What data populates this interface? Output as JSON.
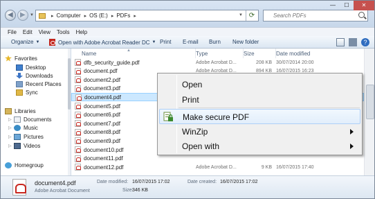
{
  "window": {
    "address": {
      "crumbs": [
        "Computer",
        "OS (E:)",
        "PDFs"
      ]
    },
    "search": {
      "placeholder": "Search PDFs"
    },
    "controls": {
      "minimize": "—",
      "maximize": "☐",
      "close": "✕"
    }
  },
  "menu": [
    "File",
    "Edit",
    "View",
    "Tools",
    "Help"
  ],
  "toolbar": {
    "organize": "Organize",
    "open_with": "Open with Adobe Acrobat Reader DC",
    "print": "Print",
    "email": "E-mail",
    "burn": "Burn",
    "new_folder": "New folder"
  },
  "nav": {
    "favorites": "Favorites",
    "desktop": "Desktop",
    "downloads": "Downloads",
    "recent": "Recent Places",
    "sync": "Sync",
    "libraries": "Libraries",
    "documents": "Documents",
    "music": "Music",
    "pictures": "Pictures",
    "videos": "Videos",
    "homegroup": "Homegroup"
  },
  "columns": {
    "name": "Name",
    "type": "Type",
    "size": "Size",
    "date": "Date modified"
  },
  "files": [
    {
      "name": "dfb_security_guide.pdf",
      "type": "Adobe Acrobat D...",
      "size": "208 KB",
      "date": "30/07/2014 20:00"
    },
    {
      "name": "document.pdf",
      "type": "Adobe Acrobat D...",
      "size": "894 KB",
      "date": "16/07/2015 16:23"
    },
    {
      "name": "document2.pdf",
      "type": "",
      "size": "",
      "date": ""
    },
    {
      "name": "document3.pdf",
      "type": "",
      "size": "",
      "date": ""
    },
    {
      "name": "document4.pdf",
      "type": "",
      "size": "",
      "date": ""
    },
    {
      "name": "document5.pdf",
      "type": "",
      "size": "",
      "date": ""
    },
    {
      "name": "document6.pdf",
      "type": "",
      "size": "",
      "date": ""
    },
    {
      "name": "document7.pdf",
      "type": "",
      "size": "",
      "date": ""
    },
    {
      "name": "document8.pdf",
      "type": "",
      "size": "",
      "date": ""
    },
    {
      "name": "document9.pdf",
      "type": "",
      "size": "",
      "date": ""
    },
    {
      "name": "document10.pdf",
      "type": "",
      "size": "",
      "date": ""
    },
    {
      "name": "document11.pdf",
      "type": "",
      "size": "",
      "date": ""
    },
    {
      "name": "document12.pdf",
      "type": "Adobe Acrobat D...",
      "size": "9 KB",
      "date": "16/07/2015 17:40"
    }
  ],
  "selected_file_index": 4,
  "context_menu": {
    "open": "Open",
    "print": "Print",
    "make_secure": "Make secure PDF",
    "winzip": "WinZip",
    "open_with": "Open with"
  },
  "details": {
    "name": "document4.pdf",
    "type": "Adobe Acrobat Document",
    "modified_label": "Date modified:",
    "modified_value": "16/07/2015 17:02",
    "created_label": "Date created:",
    "created_value": "16/07/2015 17:02",
    "size_label": "Size:",
    "size_value": "346 KB"
  },
  "colors": {
    "selection": "#cce8ff",
    "pdf_red": "#c8271f",
    "close_red": "#c6514e"
  }
}
